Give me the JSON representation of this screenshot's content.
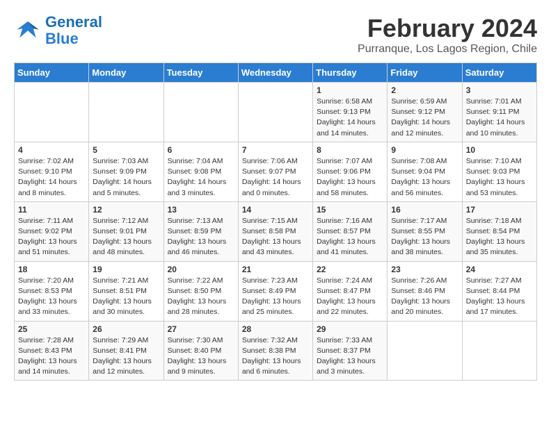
{
  "header": {
    "logo_general": "General",
    "logo_blue": "Blue",
    "month_year": "February 2024",
    "location": "Purranque, Los Lagos Region, Chile"
  },
  "days_of_week": [
    "Sunday",
    "Monday",
    "Tuesday",
    "Wednesday",
    "Thursday",
    "Friday",
    "Saturday"
  ],
  "weeks": [
    [
      {
        "day": "",
        "info": ""
      },
      {
        "day": "",
        "info": ""
      },
      {
        "day": "",
        "info": ""
      },
      {
        "day": "",
        "info": ""
      },
      {
        "day": "1",
        "info": "Sunrise: 6:58 AM\nSunset: 9:13 PM\nDaylight: 14 hours\nand 14 minutes."
      },
      {
        "day": "2",
        "info": "Sunrise: 6:59 AM\nSunset: 9:12 PM\nDaylight: 14 hours\nand 12 minutes."
      },
      {
        "day": "3",
        "info": "Sunrise: 7:01 AM\nSunset: 9:11 PM\nDaylight: 14 hours\nand 10 minutes."
      }
    ],
    [
      {
        "day": "4",
        "info": "Sunrise: 7:02 AM\nSunset: 9:10 PM\nDaylight: 14 hours\nand 8 minutes."
      },
      {
        "day": "5",
        "info": "Sunrise: 7:03 AM\nSunset: 9:09 PM\nDaylight: 14 hours\nand 5 minutes."
      },
      {
        "day": "6",
        "info": "Sunrise: 7:04 AM\nSunset: 9:08 PM\nDaylight: 14 hours\nand 3 minutes."
      },
      {
        "day": "7",
        "info": "Sunrise: 7:06 AM\nSunset: 9:07 PM\nDaylight: 14 hours\nand 0 minutes."
      },
      {
        "day": "8",
        "info": "Sunrise: 7:07 AM\nSunset: 9:06 PM\nDaylight: 13 hours\nand 58 minutes."
      },
      {
        "day": "9",
        "info": "Sunrise: 7:08 AM\nSunset: 9:04 PM\nDaylight: 13 hours\nand 56 minutes."
      },
      {
        "day": "10",
        "info": "Sunrise: 7:10 AM\nSunset: 9:03 PM\nDaylight: 13 hours\nand 53 minutes."
      }
    ],
    [
      {
        "day": "11",
        "info": "Sunrise: 7:11 AM\nSunset: 9:02 PM\nDaylight: 13 hours\nand 51 minutes."
      },
      {
        "day": "12",
        "info": "Sunrise: 7:12 AM\nSunset: 9:01 PM\nDaylight: 13 hours\nand 48 minutes."
      },
      {
        "day": "13",
        "info": "Sunrise: 7:13 AM\nSunset: 8:59 PM\nDaylight: 13 hours\nand 46 minutes."
      },
      {
        "day": "14",
        "info": "Sunrise: 7:15 AM\nSunset: 8:58 PM\nDaylight: 13 hours\nand 43 minutes."
      },
      {
        "day": "15",
        "info": "Sunrise: 7:16 AM\nSunset: 8:57 PM\nDaylight: 13 hours\nand 41 minutes."
      },
      {
        "day": "16",
        "info": "Sunrise: 7:17 AM\nSunset: 8:55 PM\nDaylight: 13 hours\nand 38 minutes."
      },
      {
        "day": "17",
        "info": "Sunrise: 7:18 AM\nSunset: 8:54 PM\nDaylight: 13 hours\nand 35 minutes."
      }
    ],
    [
      {
        "day": "18",
        "info": "Sunrise: 7:20 AM\nSunset: 8:53 PM\nDaylight: 13 hours\nand 33 minutes."
      },
      {
        "day": "19",
        "info": "Sunrise: 7:21 AM\nSunset: 8:51 PM\nDaylight: 13 hours\nand 30 minutes."
      },
      {
        "day": "20",
        "info": "Sunrise: 7:22 AM\nSunset: 8:50 PM\nDaylight: 13 hours\nand 28 minutes."
      },
      {
        "day": "21",
        "info": "Sunrise: 7:23 AM\nSunset: 8:49 PM\nDaylight: 13 hours\nand 25 minutes."
      },
      {
        "day": "22",
        "info": "Sunrise: 7:24 AM\nSunset: 8:47 PM\nDaylight: 13 hours\nand 22 minutes."
      },
      {
        "day": "23",
        "info": "Sunrise: 7:26 AM\nSunset: 8:46 PM\nDaylight: 13 hours\nand 20 minutes."
      },
      {
        "day": "24",
        "info": "Sunrise: 7:27 AM\nSunset: 8:44 PM\nDaylight: 13 hours\nand 17 minutes."
      }
    ],
    [
      {
        "day": "25",
        "info": "Sunrise: 7:28 AM\nSunset: 8:43 PM\nDaylight: 13 hours\nand 14 minutes."
      },
      {
        "day": "26",
        "info": "Sunrise: 7:29 AM\nSunset: 8:41 PM\nDaylight: 13 hours\nand 12 minutes."
      },
      {
        "day": "27",
        "info": "Sunrise: 7:30 AM\nSunset: 8:40 PM\nDaylight: 13 hours\nand 9 minutes."
      },
      {
        "day": "28",
        "info": "Sunrise: 7:32 AM\nSunset: 8:38 PM\nDaylight: 13 hours\nand 6 minutes."
      },
      {
        "day": "29",
        "info": "Sunrise: 7:33 AM\nSunset: 8:37 PM\nDaylight: 13 hours\nand 3 minutes."
      },
      {
        "day": "",
        "info": ""
      },
      {
        "day": "",
        "info": ""
      }
    ]
  ]
}
